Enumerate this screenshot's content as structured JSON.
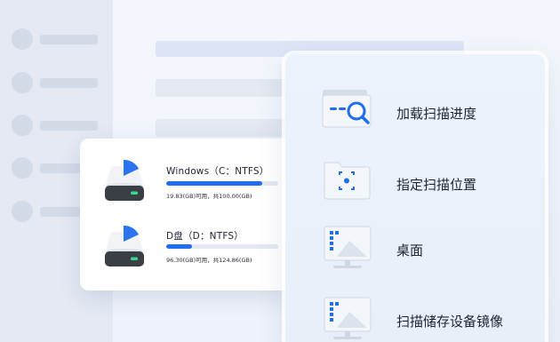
{
  "drives": [
    {
      "name": "Windows（C：NTFS）",
      "usage_text": "19.83(GB)可用，共100.00(GB)",
      "fill_fraction": 0.86
    },
    {
      "name": "D盘（D：NTFS）",
      "usage_text": "96.30(GB)可用，共124.86(GB)",
      "fill_fraction": 0.23
    }
  ],
  "scan_options": [
    {
      "label": "加载扫描进度",
      "icon": "folder-search-icon"
    },
    {
      "label": "指定扫描位置",
      "icon": "folder-target-icon"
    },
    {
      "label": "桌面",
      "icon": "desktop-monitor-icon"
    },
    {
      "label": "扫描储存设备镜像",
      "icon": "image-monitor-icon"
    }
  ],
  "colors": {
    "accent": "#1f6ff0",
    "progress_track": "#e3e8f2"
  }
}
